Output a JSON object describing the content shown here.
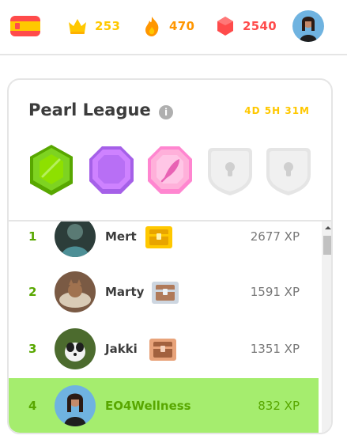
{
  "topbar": {
    "flag_icon": "spain-flag-icon",
    "crowns": {
      "icon": "crown-icon",
      "value": "253",
      "color": "#ffc800"
    },
    "streak": {
      "icon": "flame-icon",
      "value": "470",
      "color": "#ff9600"
    },
    "gems": {
      "icon": "gem-icon",
      "value": "2540",
      "color": "#ff4b4b"
    },
    "profile_icon": "profile-avatar-icon"
  },
  "league": {
    "title": "Pearl League",
    "info_icon_glyph": "i",
    "time_left": "4D 5H 31M",
    "badges": [
      {
        "name": "emerald-league-icon",
        "state": "unlocked",
        "color": "#7ed321"
      },
      {
        "name": "amethyst-league-icon",
        "state": "unlocked",
        "color": "#ce82ff"
      },
      {
        "name": "pearl-league-icon",
        "state": "current",
        "color": "#ffb0da"
      },
      {
        "name": "locked-league-icon",
        "state": "locked",
        "color": "#e5e5e5"
      },
      {
        "name": "locked-league-icon",
        "state": "locked",
        "color": "#e5e5e5"
      }
    ],
    "rows": [
      {
        "rank": "1",
        "name": "Mert",
        "xp": "2677 XP",
        "chest": "gold-chest-icon",
        "current": false
      },
      {
        "rank": "2",
        "name": "Marty",
        "xp": "1591 XP",
        "chest": "silver-chest-icon",
        "current": false
      },
      {
        "rank": "3",
        "name": "Jakki",
        "xp": "1351 XP",
        "chest": "bronze-chest-icon",
        "current": false
      },
      {
        "rank": "4",
        "name": "EO4Wellness",
        "xp": "832 XP",
        "chest": "",
        "current": true
      }
    ]
  },
  "colors": {
    "rank_green": "#58a700",
    "highlight": "#a5ed6e",
    "border": "#e5e5e5"
  }
}
